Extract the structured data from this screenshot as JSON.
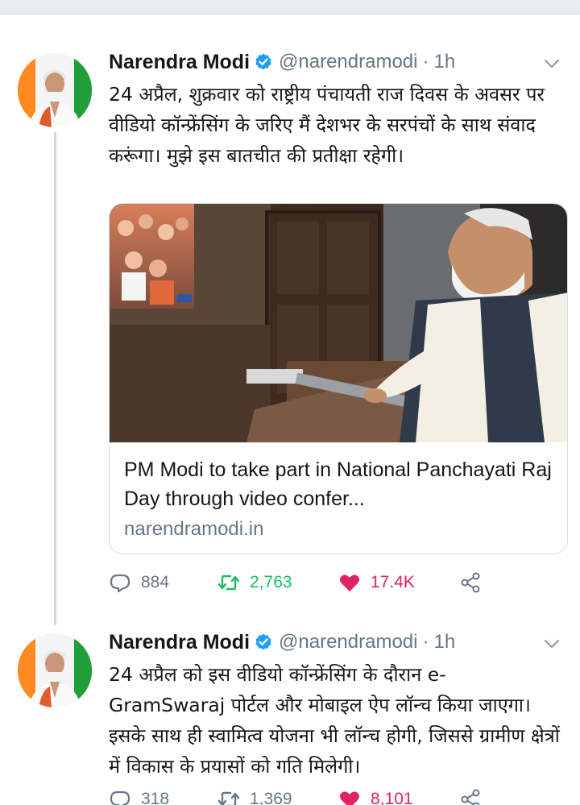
{
  "colors": {
    "text": "#14171a",
    "muted": "#657786",
    "verified": "#1da1f2",
    "retweet_active": "#17bf63",
    "like_active": "#e0245e",
    "border": "#d6dde3"
  },
  "tweets": [
    {
      "author": "Narendra Modi",
      "handle": "@narendramodi",
      "separator": "·",
      "time": "1h",
      "text": "24 अप्रैल, शुक्रवार को राष्ट्रीय पंचायती राज दिवस के अवसर पर वीडियो कॉन्फ्रेंसिंग के जरिए मैं देशभर के सरपंचों के साथ संवाद करूंगा। मुझे इस बातचीत की प्रतीक्षा रहेगी।",
      "card": {
        "title": "PM Modi to take part in National Panchayati Raj Day through video confer...",
        "domain": "narendramodi.in"
      },
      "replies": "884",
      "retweets": "2,763",
      "likes": "17.4K",
      "icons": [
        "reply-icon",
        "retweet-icon",
        "like-icon",
        "share-icon"
      ]
    },
    {
      "author": "Narendra Modi",
      "handle": "@narendramodi",
      "separator": "·",
      "time": "1h",
      "text": "24 अप्रैल को इस वीडियो कॉन्फ्रेंसिंग के दौरान e-GramSwaraj पोर्टल और मोबाइल ऐप लॉन्च किया जाएगा। इसके साथ ही स्वामित्व योजना भी लॉन्च होगी, जिससे ग्रामीण क्षेत्रों में विकास के प्रयासों को गति मिलेगी।",
      "replies": "318",
      "retweets": "1,369",
      "likes": "8,101",
      "icons": [
        "reply-icon",
        "retweet-icon",
        "like-icon",
        "share-icon"
      ]
    }
  ]
}
